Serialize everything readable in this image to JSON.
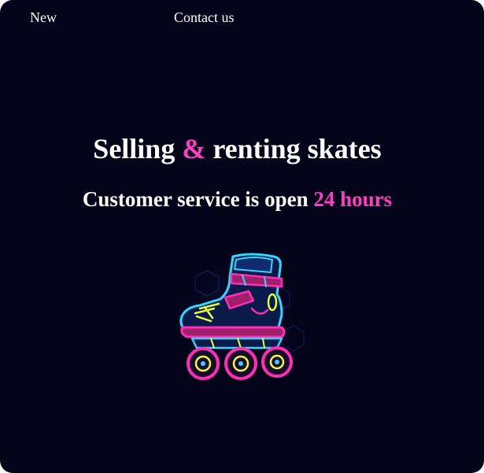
{
  "nav": {
    "items": [
      {
        "label": "New"
      },
      {
        "label": "Contact us"
      }
    ]
  },
  "hero": {
    "title_part1": "Selling ",
    "title_accent": "&",
    "title_part2": " renting skates",
    "subtitle_part1": "Customer service is open ",
    "subtitle_accent": "24 hours"
  },
  "image": {
    "icon": "neon-inline-skate-icon"
  },
  "colors": {
    "background": "#03031a",
    "text": "#ffffff",
    "accent": "#ff3fbf",
    "neon_cyan": "#33d6ff",
    "neon_pink": "#ff2fb3",
    "neon_yellow": "#e6ff3a"
  }
}
